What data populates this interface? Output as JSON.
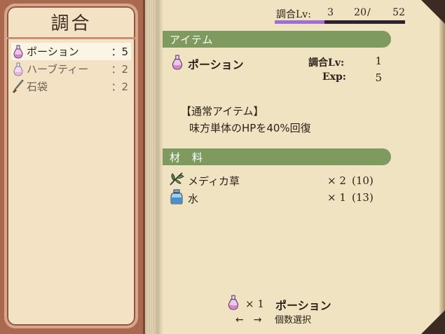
{
  "left": {
    "title": "調合",
    "items": [
      {
        "name": "ポーション",
        "qty_label": "：5",
        "icon": "potion-icon"
      },
      {
        "name": "ハーブティー",
        "qty_label": "：2",
        "icon": "potion-icon"
      },
      {
        "name": "石袋",
        "qty_label": "：2",
        "icon": "sword-icon"
      }
    ]
  },
  "level_bar": {
    "label": "調合Lv:",
    "level": "3",
    "current": "20",
    "slash": "/",
    "max": "52",
    "progress": 0.38,
    "fill_color": "#9e6dd8"
  },
  "item_section": {
    "header": "アイテム",
    "name": "ポーション",
    "lv_label": "調合Lv:",
    "lv_value": "1",
    "exp_label": "Exp:",
    "exp_value": "5",
    "category": "【通常アイテム】",
    "description": "味方単体のHPを40%回復"
  },
  "materials": {
    "header": "材　料",
    "rows": [
      {
        "name": "メディカ草",
        "amount": "× 2",
        "owned": "(10)",
        "icon": "herb-icon"
      },
      {
        "name": "水",
        "amount": "× 1",
        "owned": "(13)",
        "icon": "water-jar-icon"
      }
    ]
  },
  "footer": {
    "count": "× 1",
    "item_name": "ポーション",
    "arrows": "←　→",
    "hint": "個数選択"
  },
  "colors": {
    "section_header": "#7f9a5f",
    "panel_frame": "#a8694f",
    "page": "#efe3c2"
  }
}
